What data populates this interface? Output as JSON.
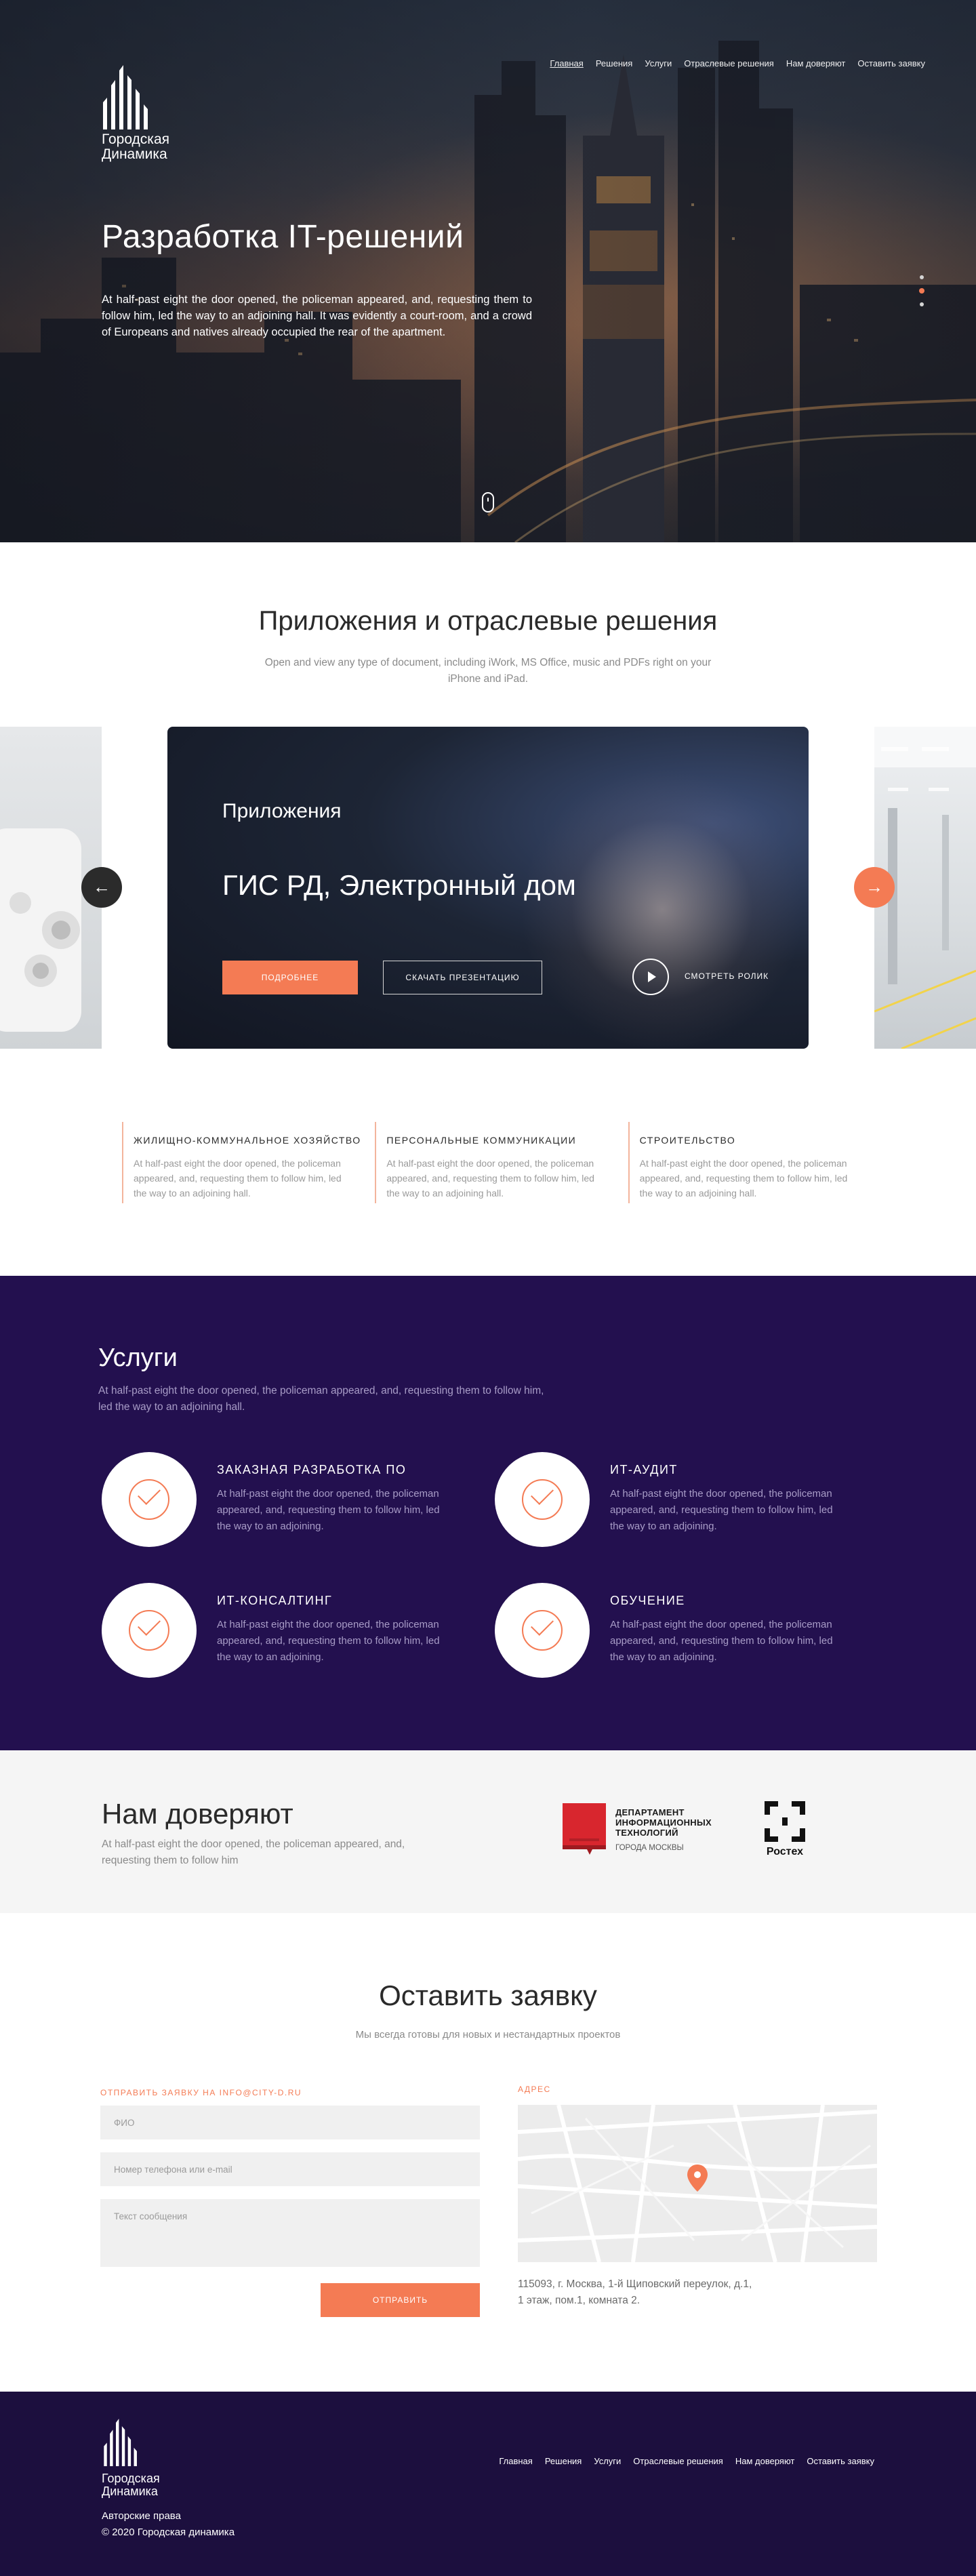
{
  "brand": {
    "line1": "Городская",
    "line2": "Динамика"
  },
  "nav": [
    "Главная",
    "Решения",
    "Услуги",
    "Отраслевые решения",
    "Нам доверяют",
    "Оставить заявку"
  ],
  "hero": {
    "title": "Разработка  IT-решений",
    "text": "At half-past eight the door opened, the policeman appeared, and, requesting them to follow him, led the way to an adjoining hall. It was evidently a court-room, and a crowd of Europeans and natives already occupied the rear of the apartment."
  },
  "apps": {
    "title": "Приложения и отраслевые решения",
    "subtitle": "Open and view any type of document, including iWork, MS Office, music and PDFs right on your iPhone and iPad.",
    "card": {
      "kicker": "Приложения",
      "headline": "ГИС РД, Электронный дом",
      "more_label": "ПОДРОБНЕЕ",
      "download_label": "СКАЧАТЬ ПРЕЗЕНТАЦИЮ",
      "watch_label": "СМОТРЕТЬ РОЛИК"
    },
    "prev_glyph": "←",
    "next_glyph": "→",
    "features": [
      {
        "title": "ЖИЛИЩНО-КОММУНАЛЬНОЕ ХОЗЯЙСТВО",
        "text": "At half-past eight the door opened, the policeman appeared, and, requesting them to follow him, led the way to an adjoining hall."
      },
      {
        "title": "ПЕРСОНАЛЬНЫЕ КОММУНИКАЦИИ",
        "text": "At half-past eight the door opened, the policeman appeared, and, requesting them to follow him, led the way to an adjoining hall."
      },
      {
        "title": "СТРОИТЕЛЬСТВО",
        "text": "At half-past eight the door opened, the policeman appeared, and, requesting them to follow him, led the way to an adjoining hall."
      }
    ]
  },
  "services": {
    "title": "Услуги",
    "subtitle": "At half-past eight the door opened, the policeman appeared, and, requesting them to follow him, led the way to an adjoining hall.",
    "items": [
      {
        "title": "ЗАКАЗНАЯ РАЗРАБОТКА ПО",
        "text": "At half-past eight the door opened, the policeman appeared, and, requesting them to follow him, led the way to an adjoining."
      },
      {
        "title": "ИТ-АУДИТ",
        "text": "At half-past eight the door opened, the policeman appeared, and, requesting them to follow him, led the way to an adjoining."
      },
      {
        "title": "ИТ-КОНСАЛТИНГ",
        "text": "At half-past eight the door opened, the policeman appeared, and, requesting them to follow him, led the way to an adjoining."
      },
      {
        "title": "ОБУЧЕНИЕ",
        "text": "At half-past eight the door opened, the policeman appeared, and, requesting them to follow him, led the way to an adjoining."
      }
    ]
  },
  "trust": {
    "title": "Нам доверяют",
    "text": "At half-past eight the door opened, the policeman appeared, and, requesting them to follow him",
    "dit": {
      "line1": "ДЕПАРТАМЕНТ",
      "line2": "ИНФОРМАЦИОННЫХ",
      "line3": "ТЕХНОЛОГИЙ",
      "city": "ГОРОДА МОСКВЫ"
    },
    "rostec": "Ростех"
  },
  "request": {
    "title": "Оставить заявку",
    "subtitle": "Мы всегда готовы для новых и нестандартных проектов",
    "email_label": "ОТПРАВИТЬ ЗАЯВКУ НА INFO@CITY-D.RU",
    "address_label": "АДРЕС",
    "fio_placeholder": "ФИО",
    "contact_placeholder": "Номер телефона или e-mail",
    "message_placeholder": "Текст сообщения",
    "send_label": "ОТПРАВИТЬ",
    "address_line1": "115093, г. Москва, 1-й Щиповский переулок, д.1,",
    "address_line2": "1 этаж, пом.1, комната 2."
  },
  "footer": {
    "rights": "Авторские права",
    "copyright": "© 2020 Городская динамика"
  },
  "colors": {
    "accent": "#f47b54",
    "services_bg": "#23104f",
    "footer_bg": "#1c0f3e"
  }
}
